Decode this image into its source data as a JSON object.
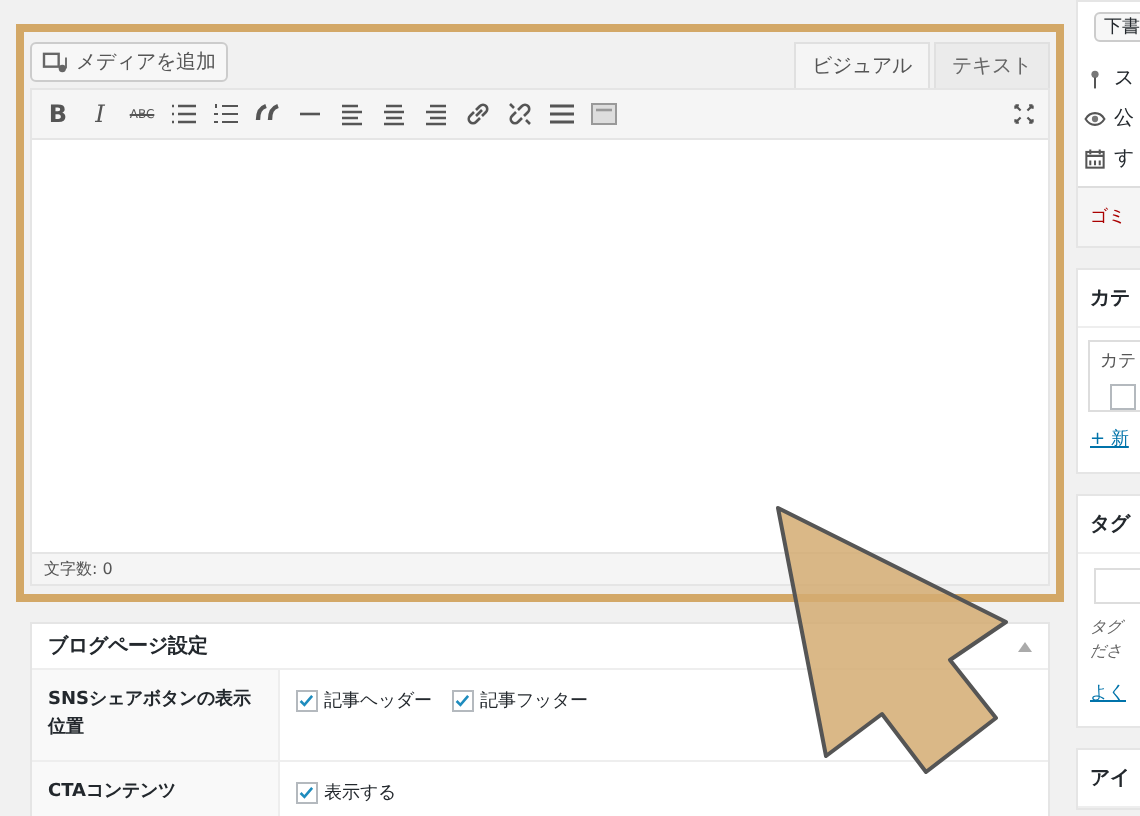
{
  "editor": {
    "add_media": "メディアを追加",
    "tabs": [
      {
        "label": "ビジュアル",
        "selected": true
      },
      {
        "label": "テキスト",
        "selected": false
      }
    ],
    "bold": "B",
    "italic": "I",
    "strike": "ABC",
    "word_count": "文字数: 0"
  },
  "blog_settings": {
    "title": "ブログページ設定",
    "rows": [
      {
        "label": "SNSシェアボタンの表示位置",
        "options": [
          {
            "label": "記事ヘッダー",
            "checked": true
          },
          {
            "label": "記事フッター",
            "checked": true
          }
        ]
      },
      {
        "label": "CTAコンテンツ",
        "options": [
          {
            "label": "表示する",
            "checked": true
          }
        ]
      }
    ]
  },
  "sidebar": {
    "publish": {
      "button": "下書",
      "items": [
        {
          "kind": "status",
          "text": "ス"
        },
        {
          "kind": "visibility",
          "text": "公"
        },
        {
          "kind": "schedule",
          "text": "す"
        }
      ],
      "trash": "ゴミ"
    },
    "categories": {
      "title": "カテ",
      "tab": "カテ",
      "checked": false,
      "new_link": "+ 新"
    },
    "tags": {
      "title": "タグ",
      "hint": [
        "タグ",
        "ださ"
      ],
      "link": "よく"
    },
    "featured": {
      "title": "アイ"
    }
  }
}
